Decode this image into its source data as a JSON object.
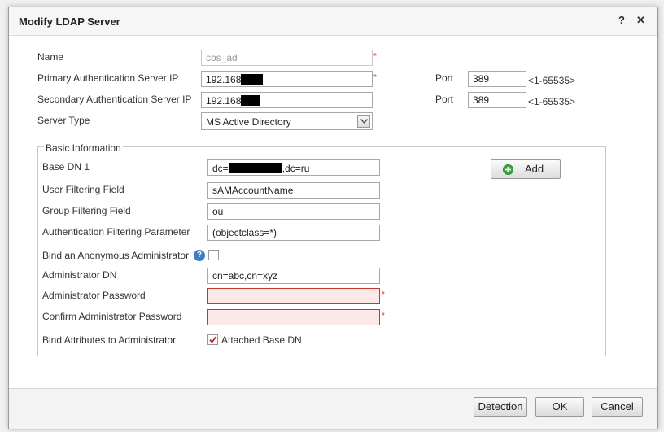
{
  "dialog": {
    "title": "Modify LDAP Server",
    "help_icon": "question-mark-icon",
    "close_icon": "close-x-icon",
    "help_glyph": "?",
    "close_glyph": "✕"
  },
  "server": {
    "name_label": "Name",
    "name_value": "cbs_ad",
    "primary_label": "Primary Authentication Server IP",
    "primary_value": "192.168",
    "secondary_label": "Secondary Authentication Server IP",
    "secondary_value": "192.168",
    "port_label": "Port",
    "primary_port": "389",
    "secondary_port": "389",
    "port_range": "<1-65535>",
    "type_label": "Server Type",
    "type_value": "MS Active Directory",
    "required_mark": "*"
  },
  "basic": {
    "legend": "Basic Information",
    "base_dn_label": "Base DN 1",
    "base_dn_prefix": "dc=",
    "base_dn_suffix": ",dc=ru",
    "add_label": "Add",
    "user_filter_label": "User Filtering Field",
    "user_filter_value": "sAMAccountName",
    "group_filter_label": "Group Filtering Field",
    "group_filter_value": "ou",
    "auth_filter_label": "Authentication Filtering Parameter",
    "auth_filter_value": "(objectclass=*)",
    "anon_label": "Bind an Anonymous Administrator",
    "anon_checked": false,
    "admin_dn_label": "Administrator DN",
    "admin_dn_value": "cn=abc,cn=xyz",
    "admin_pw_label": "Administrator Password",
    "confirm_pw_label": "Confirm Administrator Password",
    "bind_attr_label": "Bind Attributes to Administrator",
    "attached_label": "Attached Base DN",
    "attached_checked": true
  },
  "footer": {
    "detection_label": "Detection",
    "ok_label": "OK",
    "cancel_label": "Cancel"
  },
  "colors": {
    "error_bg": "#fde8e8",
    "error_border": "#c0392b",
    "required": "#dd3333",
    "help_blue": "#3a7fc1",
    "add_green": "#3aa63a"
  }
}
